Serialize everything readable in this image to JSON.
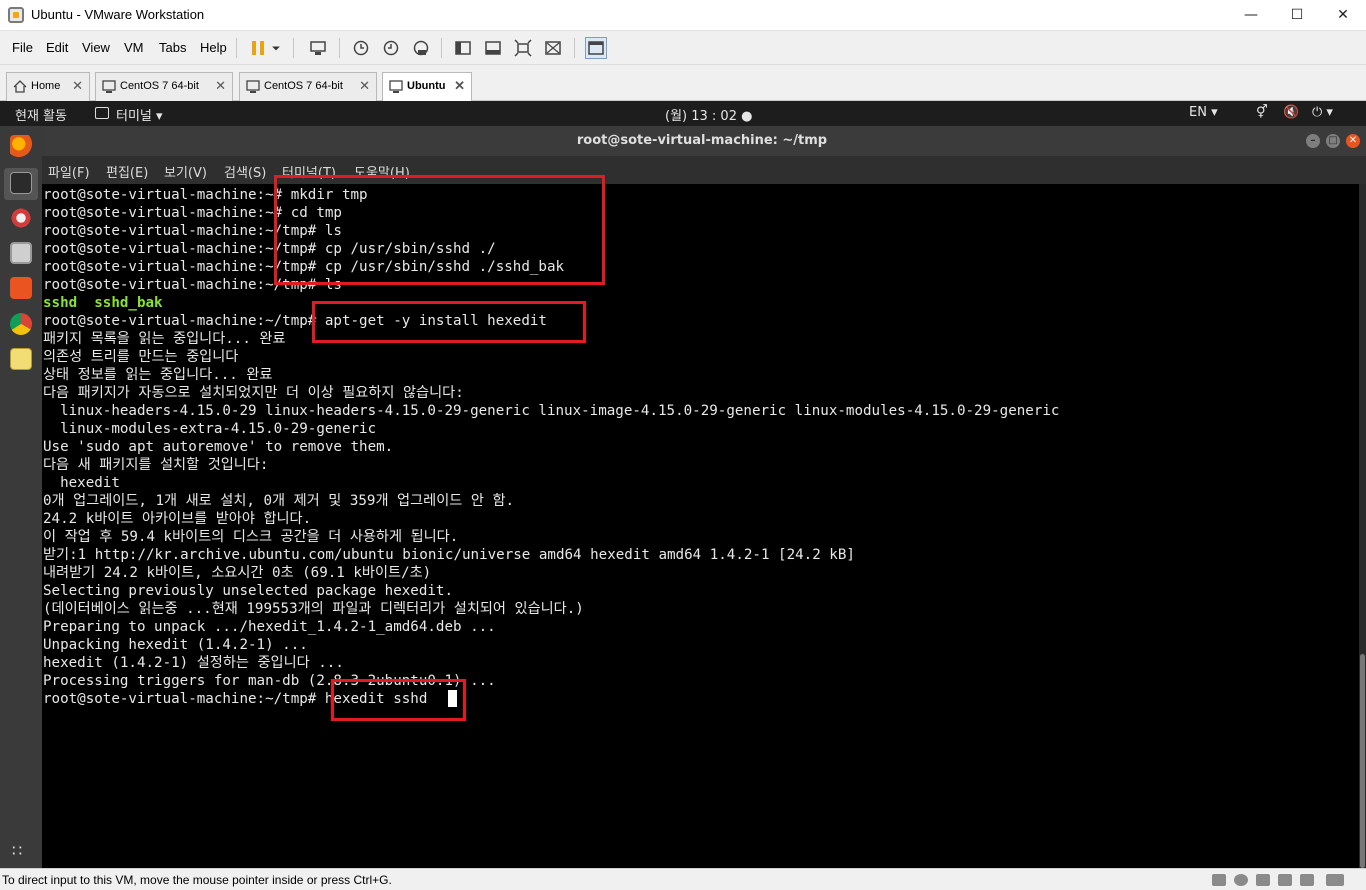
{
  "window": {
    "title": "Ubuntu - VMware Workstation"
  },
  "menubar": {
    "items": [
      "File",
      "Edit",
      "View",
      "VM",
      "Tabs",
      "Help"
    ]
  },
  "tabs": [
    {
      "label": "Home",
      "icon": "home-icon",
      "active": false
    },
    {
      "label": "CentOS 7 64-bit",
      "icon": "vm-icon",
      "active": false
    },
    {
      "label": "CentOS 7 64-bit",
      "icon": "vm-icon",
      "active": false
    },
    {
      "label": "Ubuntu",
      "icon": "vm-icon",
      "active": true
    }
  ],
  "ubuntu_topbar": {
    "activities": "현재 활동",
    "app_menu": "터미널",
    "clock": "(월) 13 : 02",
    "lang": "EN"
  },
  "terminal": {
    "title": "root@sote-virtual-machine: ~/tmp",
    "menu": [
      "파일(F)",
      "편집(E)",
      "보기(V)",
      "검색(S)",
      "터미널(T)",
      "도움말(H)"
    ],
    "lines": [
      "root@sote-virtual-machine:~# mkdir tmp",
      "root@sote-virtual-machine:~# cd tmp",
      "root@sote-virtual-machine:~/tmp# ls",
      "root@sote-virtual-machine:~/tmp# cp /usr/sbin/sshd ./",
      "root@sote-virtual-machine:~/tmp# cp /usr/sbin/sshd ./sshd_bak",
      "root@sote-virtual-machine:~/tmp# ls",
      "sshd  sshd_bak",
      "root@sote-virtual-machine:~/tmp# apt-get -y install hexedit",
      "패키지 목록을 읽는 중입니다... 완료",
      "의존성 트리를 만드는 중입니다",
      "상태 정보를 읽는 중입니다... 완료",
      "다음 패키지가 자동으로 설치되었지만 더 이상 필요하지 않습니다:",
      "  linux-headers-4.15.0-29 linux-headers-4.15.0-29-generic linux-image-4.15.0-29-generic linux-modules-4.15.0-29-generic",
      "  linux-modules-extra-4.15.0-29-generic",
      "Use 'sudo apt autoremove' to remove them.",
      "다음 새 패키지를 설치할 것입니다:",
      "  hexedit",
      "0개 업그레이드, 1개 새로 설치, 0개 제거 및 359개 업그레이드 안 함.",
      "24.2 k바이트 아카이브를 받아야 합니다.",
      "이 작업 후 59.4 k바이트의 디스크 공간을 더 사용하게 됩니다.",
      "받기:1 http://kr.archive.ubuntu.com/ubuntu bionic/universe amd64 hexedit amd64 1.4.2-1 [24.2 kB]",
      "내려받기 24.2 k바이트, 소요시간 0초 (69.1 k바이트/초)",
      "Selecting previously unselected package hexedit.",
      "(데이터베이스 읽는중 ...현재 199553개의 파일과 디렉터리가 설치되어 있습니다.)",
      "Preparing to unpack .../hexedit_1.4.2-1_amd64.deb ...",
      "Unpacking hexedit (1.4.2-1) ...",
      "hexedit (1.4.2-1) 설정하는 중입니다 ...",
      "Processing triggers for man-db (2.8.3-2ubuntu0.1) ...",
      "root@sote-virtual-machine:~/tmp# hexedit sshd"
    ]
  },
  "statusbar": {
    "message": "To direct input to this VM, move the mouse pointer inside or press Ctrl+G."
  },
  "colors": {
    "accent_red": "#e01b24",
    "ubuntu_orange": "#e95420",
    "ls_green": "#8ae234"
  }
}
